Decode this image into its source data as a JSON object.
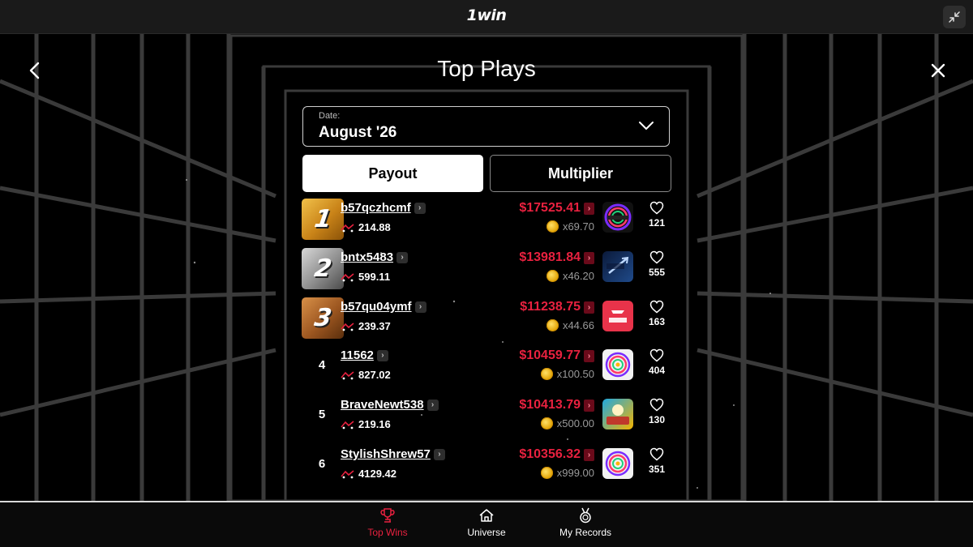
{
  "header": {
    "brand": "1win"
  },
  "page": {
    "title": "Top Plays"
  },
  "date_select": {
    "label": "Date:",
    "value": "August '26"
  },
  "tabs": [
    {
      "label": "Payout",
      "active": true
    },
    {
      "label": "Multiplier",
      "active": false
    }
  ],
  "rows": [
    {
      "rank": "1",
      "username": "b57qczhcmf",
      "points": "214.88",
      "payout": "$17525.41",
      "multiplier": "x69.70",
      "game": "vortex-icon",
      "likes": "121"
    },
    {
      "rank": "2",
      "username": "bntx5483",
      "points": "599.11",
      "payout": "$13981.84",
      "multiplier": "x46.20",
      "game": "crash-x-icon",
      "likes": "555"
    },
    {
      "rank": "3",
      "username": "b57qu04ymf",
      "points": "239.37",
      "payout": "$11238.75",
      "multiplier": "x44.66",
      "game": "aero-icon",
      "likes": "163"
    },
    {
      "rank": "4",
      "username": "11562",
      "points": "827.02",
      "payout": "$10459.77",
      "multiplier": "x100.50",
      "game": "vortex-white-icon",
      "likes": "404"
    },
    {
      "rank": "5",
      "username": "BraveNewt538",
      "points": "219.16",
      "payout": "$10413.79",
      "multiplier": "x500.00",
      "game": "chicken-route-icon",
      "likes": "130"
    },
    {
      "rank": "6",
      "username": "StylishShrew57",
      "points": "4129.42",
      "payout": "$10356.32",
      "multiplier": "x999.00",
      "game": "vortex-white-icon",
      "likes": "351"
    }
  ],
  "bottom_nav": {
    "top_wins": "Top Wins",
    "universe": "Universe",
    "my_records": "My Records"
  },
  "colors": {
    "accent": "#e8213f",
    "gold": "#d89a22",
    "silver": "#9a9a9a",
    "bronze": "#b86a2a"
  }
}
